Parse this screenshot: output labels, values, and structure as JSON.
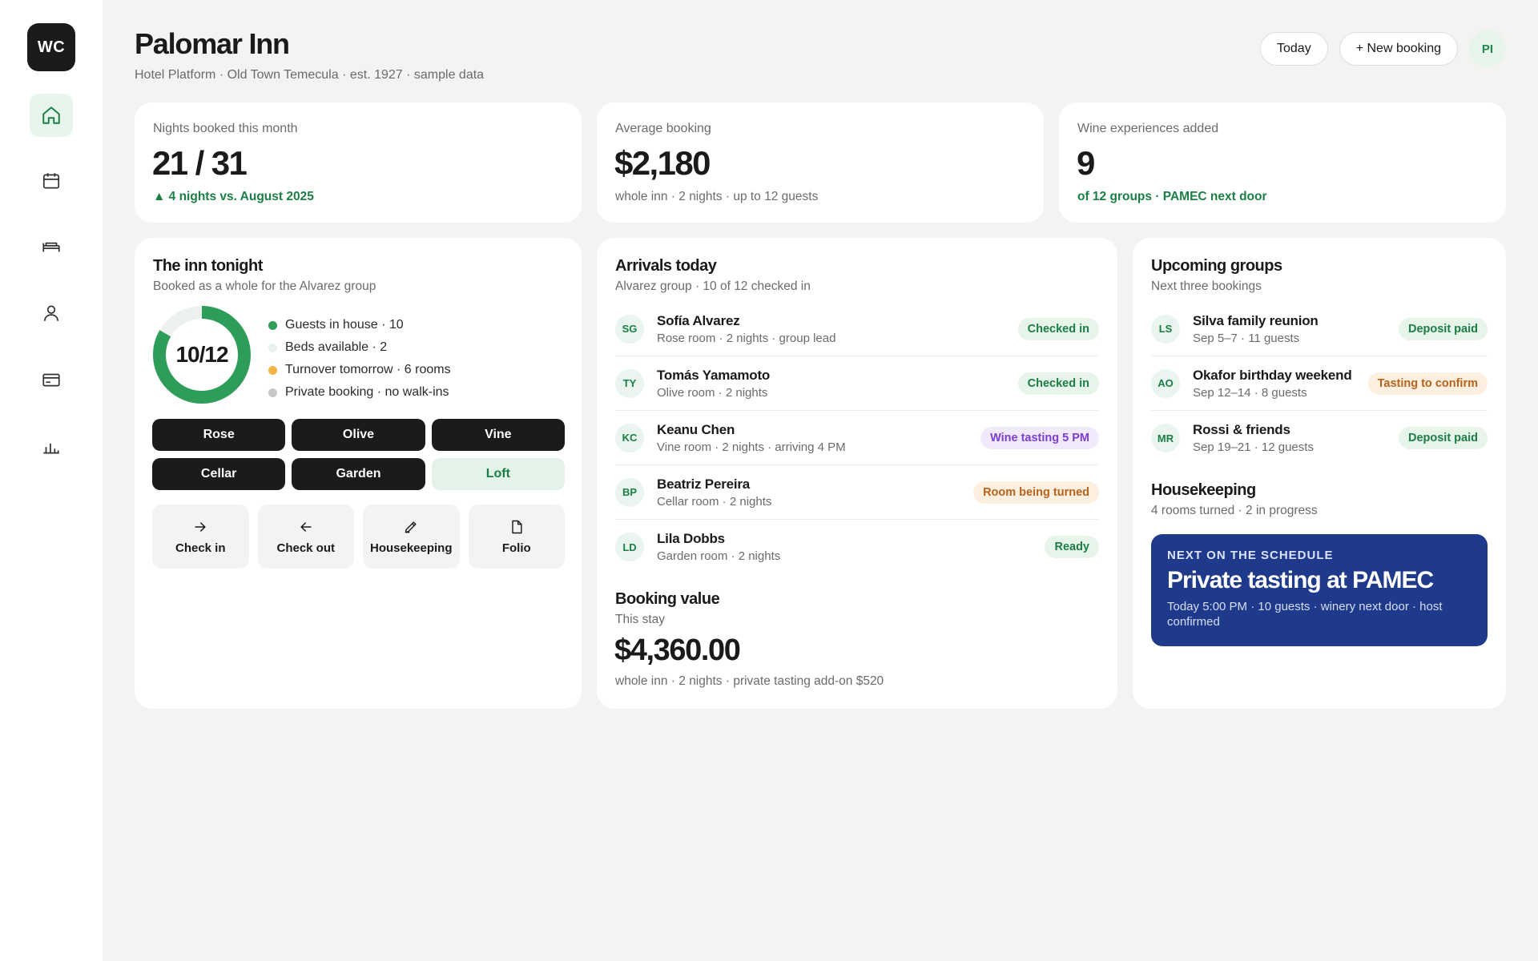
{
  "sidebar": {
    "logo": "WC",
    "nav": [
      {
        "icon": "home-icon",
        "active": true
      },
      {
        "icon": "calendar-icon",
        "active": false
      },
      {
        "icon": "bed-icon",
        "active": false
      },
      {
        "icon": "user-icon",
        "active": false
      },
      {
        "icon": "card-icon",
        "active": false
      },
      {
        "icon": "chart-icon",
        "active": false
      }
    ]
  },
  "header": {
    "title": "Palomar Inn",
    "subtitle": "Hotel Platform · Old Town Temecula · est. 1927 · sample data",
    "today_label": "Today",
    "new_booking_label": "+ New booking",
    "avatar_initials": "PI"
  },
  "stats": [
    {
      "label": "Nights booked this month",
      "value": "21 / 31",
      "foot": "▲ 4 nights vs. August 2025",
      "foot_style": "green"
    },
    {
      "label": "Average booking",
      "value": "$2,180",
      "foot": "whole inn · 2 nights · up to 12 guests",
      "foot_style": "grey"
    },
    {
      "label": "Wine experiences added",
      "value": "9",
      "foot": "of 12 groups · PAMEC next door",
      "foot_style": "green"
    }
  ],
  "inn_tonight": {
    "title": "The inn tonight",
    "subtitle": "Booked as a whole for the Alvarez group",
    "occupancy_label": "10/12",
    "occupancy": {
      "occupied": 10,
      "capacity": 12
    },
    "legend": [
      {
        "label": "Guests in house · 10",
        "color": "#2e9d5a"
      },
      {
        "label": "Beds available · 2",
        "color": "#e8f1ec"
      },
      {
        "label": "Turnover tomorrow · 6 rooms",
        "color": "#f2b544"
      },
      {
        "label": "Private booking · no walk-ins",
        "color": "#c8c8c8"
      }
    ],
    "rooms": [
      {
        "name": "Rose",
        "occupied": true
      },
      {
        "name": "Olive",
        "occupied": true
      },
      {
        "name": "Vine",
        "occupied": true
      },
      {
        "name": "Cellar",
        "occupied": true
      },
      {
        "name": "Garden",
        "occupied": true
      },
      {
        "name": "Loft",
        "occupied": false
      }
    ],
    "actions": [
      {
        "label": "Check in",
        "icon": "arrow-right-icon"
      },
      {
        "label": "Check out",
        "icon": "arrow-left-icon"
      },
      {
        "label": "Housekeeping",
        "icon": "pen-icon"
      },
      {
        "label": "Folio",
        "icon": "document-icon"
      }
    ]
  },
  "arrivals": {
    "title": "Arrivals today",
    "subtitle": "Alvarez group · 10 of 12 checked in",
    "items": [
      {
        "initials": "SG",
        "name": "Sofía Alvarez",
        "meta": "Rose room · 2 nights · group lead",
        "badge": "Checked in",
        "badge_color": "green"
      },
      {
        "initials": "TY",
        "name": "Tomás Yamamoto",
        "meta": "Olive room · 2 nights",
        "badge": "Checked in",
        "badge_color": "green"
      },
      {
        "initials": "KC",
        "name": "Keanu Chen",
        "meta": "Vine room · 2 nights · arriving 4 PM",
        "badge": "Wine tasting 5 PM",
        "badge_color": "purple"
      },
      {
        "initials": "BP",
        "name": "Beatriz Pereira",
        "meta": "Cellar room · 2 nights",
        "badge": "Room being turned",
        "badge_color": "orange"
      },
      {
        "initials": "LD",
        "name": "Lila Dobbs",
        "meta": "Garden room · 2 nights",
        "badge": "Ready",
        "badge_color": "green"
      }
    ],
    "booking_value": {
      "title": "Booking value",
      "subtitle": "This stay",
      "amount": "$4,360.00",
      "note": "whole inn · 2 nights · private tasting add-on $520"
    }
  },
  "upcoming": {
    "title": "Upcoming groups",
    "subtitle": "Next three bookings",
    "items": [
      {
        "initials": "LS",
        "name": "Silva family reunion",
        "meta": "Sep 5–7 · 11 guests",
        "badge": "Deposit paid",
        "badge_color": "green"
      },
      {
        "initials": "AO",
        "name": "Okafor birthday weekend",
        "meta": "Sep 12–14 · 8 guests",
        "badge": "Tasting to confirm",
        "badge_color": "orange"
      },
      {
        "initials": "MR",
        "name": "Rossi & friends",
        "meta": "Sep 19–21 · 12 guests",
        "badge": "Deposit paid",
        "badge_color": "green"
      }
    ],
    "housekeeping": {
      "title": "Housekeeping",
      "subtitle": "4 rooms turned · 2 in progress"
    },
    "schedule": {
      "kicker": "NEXT ON THE SCHEDULE",
      "title": "Private tasting at PAMEC",
      "meta": "Today 5:00 PM · 10 guests · winery next door · host confirmed"
    }
  },
  "colors": {
    "accent_green": "#1a7f44",
    "donut_green": "#2e9d5a",
    "schedule_blue": "#1f3a8a",
    "dark": "#1b1b1b"
  }
}
